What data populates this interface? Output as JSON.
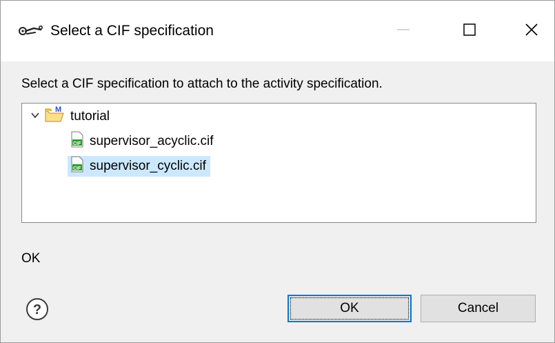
{
  "window": {
    "title": "Select a CIF specification",
    "app_icon": "eclipse-tool-icon",
    "controls": [
      "minimize-icon",
      "maximize-icon",
      "close-icon"
    ]
  },
  "dialog": {
    "instruction": "Select a CIF specification to attach to the activity specification.",
    "tree": {
      "root": {
        "label": "tutorial",
        "icon": "project-folder-icon",
        "expanded": true
      },
      "children": [
        {
          "label": "supervisor_acyclic.cif",
          "icon": "cif-file-icon",
          "selected": false
        },
        {
          "label": "supervisor_cyclic.cif",
          "icon": "cif-file-icon",
          "selected": true
        }
      ]
    },
    "status": "OK",
    "buttons": {
      "ok": "OK",
      "cancel": "Cancel"
    },
    "help_icon": "help-icon"
  },
  "colors": {
    "selection": "#cce8ff",
    "default_button_border": "#0078d7"
  }
}
